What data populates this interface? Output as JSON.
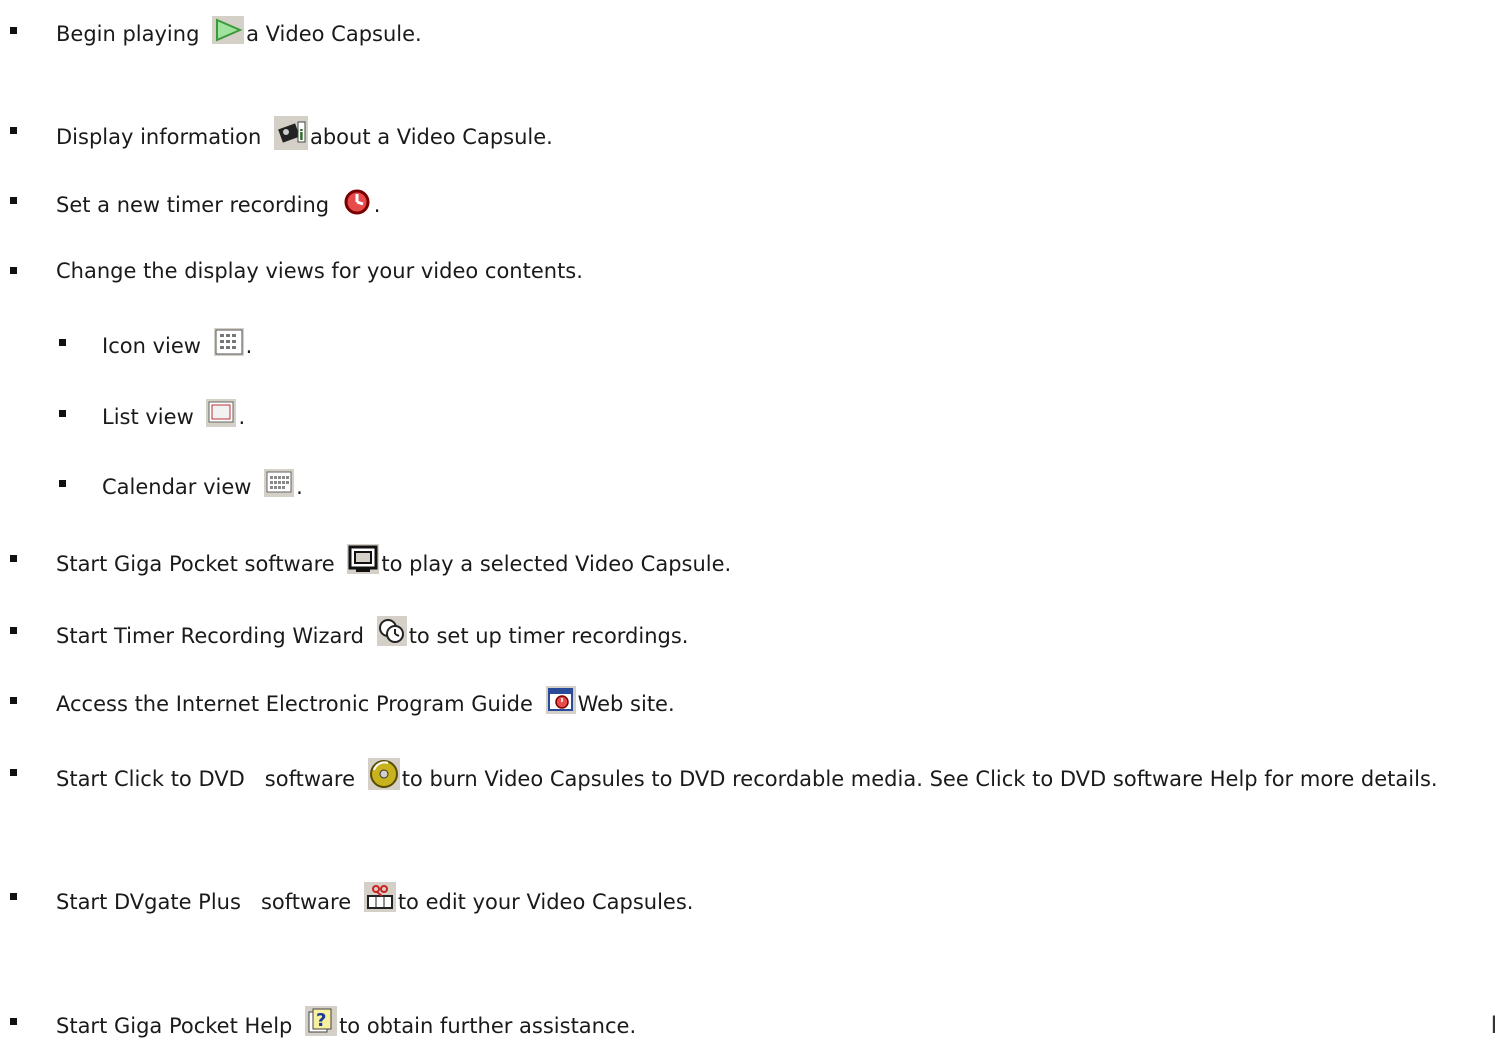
{
  "items": [
    {
      "before": "Begin playing",
      "icon": "play-icon",
      "after": "a Video Capsule."
    },
    {
      "before": "Display information",
      "icon": "video-info-icon",
      "after": "about a Video Capsule."
    },
    {
      "before": "Set a new timer recording",
      "icon": "timer-record-icon",
      "after": "."
    },
    {
      "before": "Change the display views for your video contents.",
      "icon": "",
      "after": ""
    },
    {
      "before": "Icon view",
      "icon": "icon-view-icon",
      "after": "."
    },
    {
      "before": "List view",
      "icon": "list-view-icon",
      "after": "."
    },
    {
      "before": "Calendar view",
      "icon": "calendar-view-icon",
      "after": "."
    },
    {
      "before": "Start Giga Pocket software",
      "icon": "giga-pocket-icon",
      "after": "to play a selected Video Capsule."
    },
    {
      "before": "Start Timer Recording Wizard",
      "icon": "timer-wizard-icon",
      "after": "to set up timer recordings."
    },
    {
      "before": "Access the Internet Electronic Program Guide",
      "icon": "program-guide-icon",
      "after": "Web site."
    },
    {
      "before": "Start Click to DVD   software",
      "icon": "click-to-dvd-icon",
      "after": "to burn Video Capsules to DVD recordable media. See Click to DVD software Help for more details."
    },
    {
      "before": "Start DVgate Plus   software",
      "icon": "dvgate-plus-icon",
      "after": "to edit your Video Capsules."
    },
    {
      "before": "Start Giga Pocket Help",
      "icon": "help-icon",
      "after": "to obtain further assistance."
    }
  ],
  "page_fragment": "P"
}
